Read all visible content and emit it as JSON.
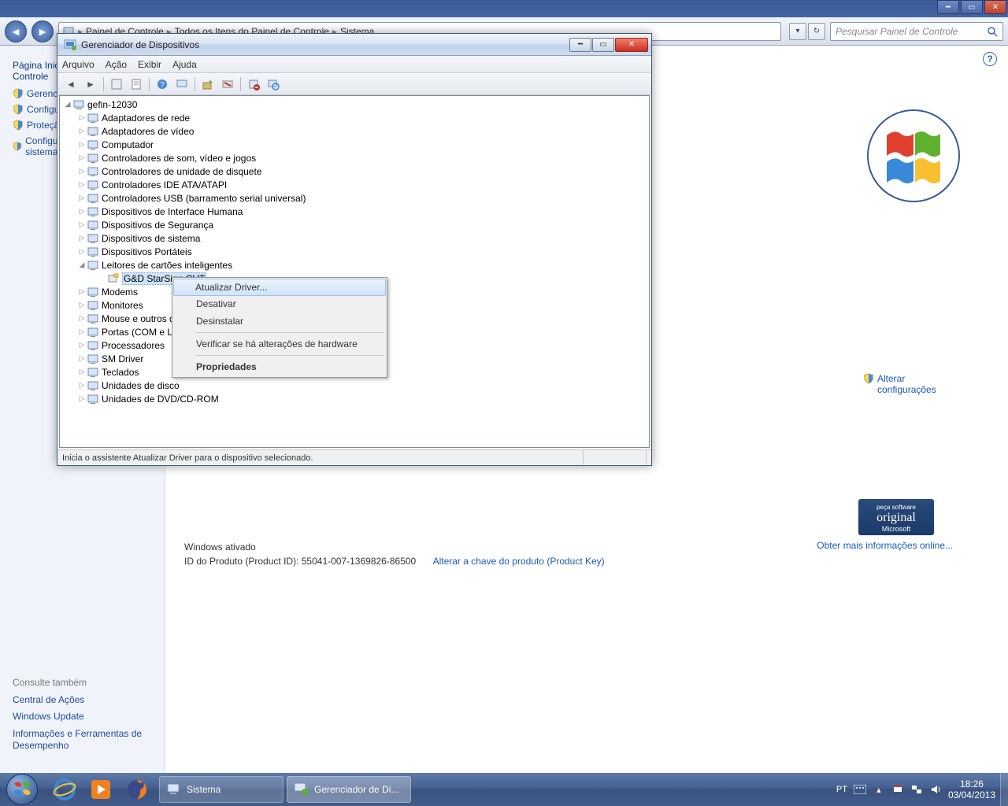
{
  "cp": {
    "breadcrumb": [
      "Painel de Controle",
      "Todos os Itens do Painel de Controle",
      "Sistema"
    ],
    "search_placeholder": "Pesquisar Painel de Controle",
    "sidebar": {
      "header": "Página Inicial do Painel de Controle",
      "links": [
        "Gerenciador de Dispositivos",
        "Configurações remotas",
        "Proteção do sistema",
        "Configurações avançadas do sistema"
      ],
      "bottom_hdr": "Consulte também",
      "bottom_links": [
        "Central de Ações",
        "Windows Update",
        "Informações e Ferramentas de Desempenho"
      ]
    },
    "activation": {
      "line1": "Windows ativado",
      "line2_label": "ID do Produto (Product ID):",
      "line2_value": "55041-007-1369826-86500",
      "link": "Alterar a chave do produto (Product Key)"
    },
    "alter_conf": "Alterar configurações",
    "more_info": "Obter mais informações online...",
    "genuine": {
      "top": "peça software",
      "mid": "original",
      "bot": "Microsoft"
    }
  },
  "dm": {
    "title": "Gerenciador de Dispositivos",
    "menu": [
      "Arquivo",
      "Ação",
      "Exibir",
      "Ajuda"
    ],
    "root": "gefin-12030",
    "categories": [
      "Adaptadores de rede",
      "Adaptadores de vídeo",
      "Computador",
      "Controladores de som, vídeo e jogos",
      "Controladores de unidade de disquete",
      "Controladores IDE ATA/ATAPI",
      "Controladores USB (barramento serial universal)",
      "Dispositivos de Interface Humana",
      "Dispositivos de Segurança",
      "Dispositivos de sistema",
      "Dispositivos Portáteis",
      "Leitores de cartões inteligentes",
      "Modems",
      "Monitores",
      "Mouse e outros dispositivos apontadores",
      "Portas (COM e LPT)",
      "Processadores",
      "SM Driver",
      "Teclados",
      "Unidades de disco",
      "Unidades de DVD/CD-ROM"
    ],
    "expanded_index": 11,
    "child": "G&D StarSign CUT",
    "status": "Inicia o assistente Atualizar Driver para o dispositivo selecionado."
  },
  "ctx": {
    "items": [
      "Atualizar Driver...",
      "Desativar",
      "Desinstalar",
      "Verificar se há alterações de hardware",
      "Propriedades"
    ]
  },
  "taskbar": {
    "tasks": [
      "Sistema",
      "Gerenciador de Di..."
    ],
    "lang": "PT",
    "time": "18:26",
    "date": "03/04/2013"
  }
}
